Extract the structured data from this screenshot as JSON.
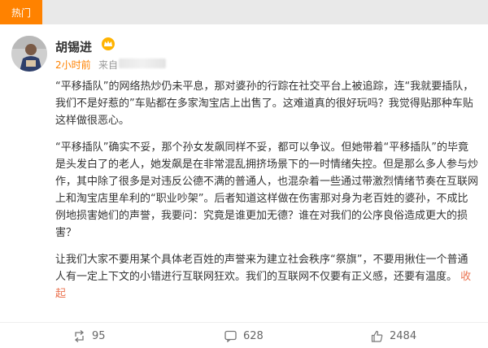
{
  "top_tab": {
    "label": "热门"
  },
  "user": {
    "name": "胡锡进",
    "time": "2小时前",
    "source_prefix": "来自"
  },
  "post": {
    "paragraphs": [
      "“平移插队”的网络热炒仍未平息，那对婆孙的行踪在社交平台上被追踪，连“我就要插队，我们不是好惹的”车贴都在多家淘宝店上出售了。这难道真的很好玩吗？我觉得贴那种车贴这样做很恶心。",
      "“平移插队”确实不妥，那个孙女发飙同样不妥，都可以争议。但她带着“平移插队”的毕竟是头发白了的老人，她发飙是在非常混乱拥挤场景下的一时情绪失控。但是那么多人参与炒作，其中除了很多是对违反公德不满的普通人，也混杂着一些通过带激烈情绪节奏在互联网上和淘宝店里牟利的“职业吵架”。后者知道这样做在伤害那对身为老百姓的婆孙，不成比例地损害她们的声誉，我要问：究竟是谁更加无德？谁在对我们的公序良俗造成更大的损害？"
    ],
    "last_paragraph": "让我们大家不要用某个具体老百姓的声誉来为建立社会秩序“祭旗”，不要用揪住一个普通人有一定上下文的小错进行互联网狂欢。我们的互联网不仅要有正义感，还要有温度。",
    "collapse_label": "收起"
  },
  "actions": {
    "repost_count": "95",
    "comment_count": "628",
    "like_count": "2484"
  },
  "colors": {
    "accent": "#ff8200",
    "link": "#eb7350"
  }
}
